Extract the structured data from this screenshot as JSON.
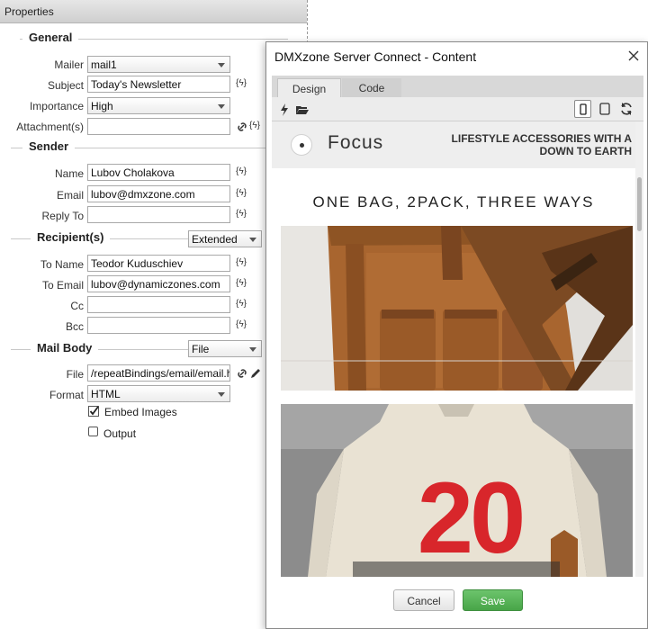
{
  "panel": {
    "title": "Properties",
    "sections": {
      "general": "General",
      "sender": "Sender",
      "recipients": "Recipient(s)",
      "mailbody": "Mail Body"
    },
    "fields": {
      "mailer": {
        "label": "Mailer",
        "value": "mail1"
      },
      "subject": {
        "label": "Subject",
        "value": "Today's Newsletter"
      },
      "importance": {
        "label": "Importance",
        "value": "High"
      },
      "attachments": {
        "label": "Attachment(s)",
        "value": ""
      },
      "name": {
        "label": "Name",
        "value": "Lubov Cholakova"
      },
      "email": {
        "label": "Email",
        "value": "lubov@dmxzone.com"
      },
      "reply_to": {
        "label": "Reply To",
        "value": ""
      },
      "recipients_mode": "Extended",
      "to_name": {
        "label": "To Name",
        "value": "Teodor Kuduschiev"
      },
      "to_email": {
        "label": "To Email",
        "value": "lubov@dynamiczones.com"
      },
      "cc": {
        "label": "Cc",
        "value": ""
      },
      "bcc": {
        "label": "Bcc",
        "value": ""
      },
      "body_mode": "File",
      "file": {
        "label": "File",
        "value": "/repeatBindings/email/email.ht"
      },
      "format": {
        "label": "Format",
        "value": "HTML"
      },
      "embed_images": {
        "label": "Embed Images",
        "checked": true
      },
      "output": {
        "label": "Output",
        "checked": false
      }
    },
    "dynamic_icon_text": "{ϟ}"
  },
  "dialog": {
    "title": "DMXzone Server Connect - Content",
    "tabs": [
      "Design",
      "Code"
    ],
    "active_tab": "Design",
    "preview": {
      "brand": "Focus",
      "tagline": "LIFESTYLE ACCESSORIES WITH A DOWN TO EARTH",
      "headline": "ONE BAG, 2PACK, THREE WAYS",
      "shirt_number": "20"
    },
    "buttons": {
      "cancel": "Cancel",
      "save": "Save"
    }
  },
  "colors": {
    "accent_save": "#4aa74a",
    "shirt_red": "#d8262b",
    "leather": "#a8652f"
  }
}
